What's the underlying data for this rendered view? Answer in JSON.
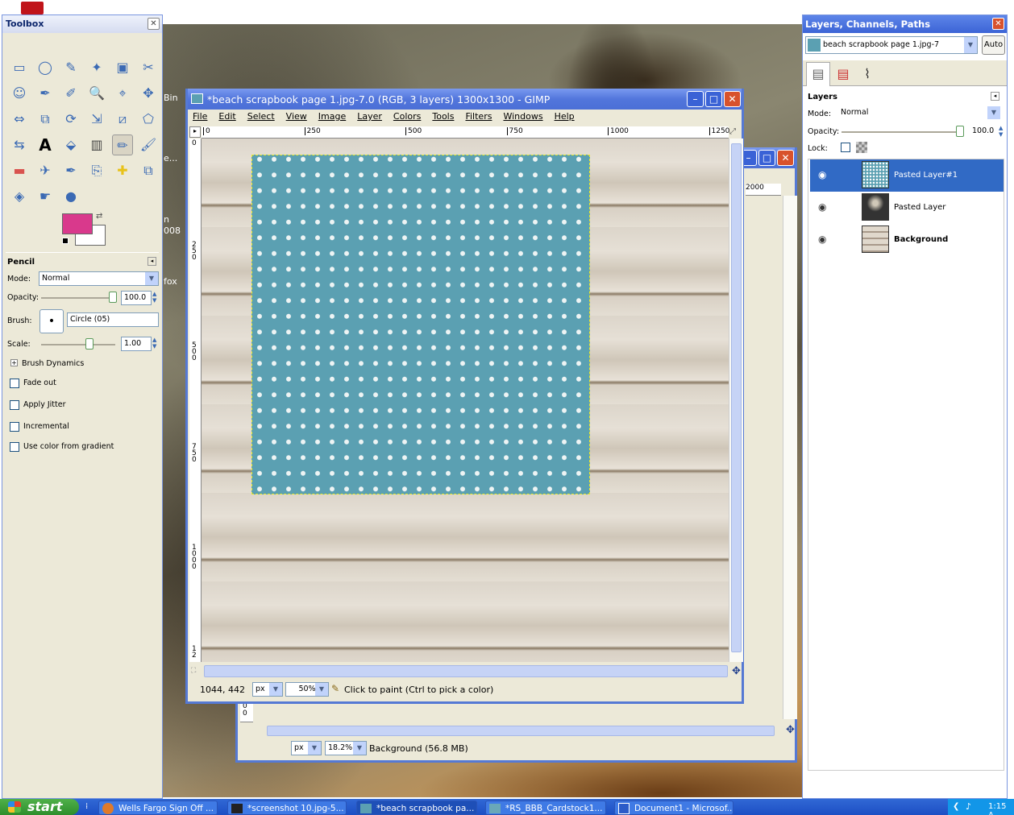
{
  "desktop": {
    "fragments": [
      "Bin",
      "e...",
      "n",
      "008",
      "fox"
    ]
  },
  "toolbox": {
    "title": "Toolbox",
    "tool_icons": [
      "rect-select-icon",
      "ellipse-select-icon",
      "free-select-icon",
      "fuzzy-select-icon",
      "color-select-icon",
      "scissors-icon",
      "foreground-select-icon",
      "paths-icon",
      "color-picker-icon",
      "zoom-icon",
      "measure-icon",
      "move-icon",
      "align-icon",
      "crop-icon",
      "rotate-icon",
      "scale-icon",
      "shear-icon",
      "perspective-icon",
      "flip-icon",
      "text-icon",
      "bucket-fill-icon",
      "blend-icon",
      "pencil-icon",
      "paintbrush-icon",
      "eraser-icon",
      "airbrush-icon",
      "ink-icon",
      "clone-icon",
      "heal-icon",
      "perspective-clone-icon",
      "blur-icon",
      "smudge-icon",
      "dodge-burn-icon"
    ],
    "fg_color": "#d9398c",
    "bg_color": "#ffffff",
    "options": {
      "title": "Pencil",
      "mode_label": "Mode:",
      "mode_value": "Normal",
      "opacity_label": "Opacity:",
      "opacity_value": "100.0",
      "brush_label": "Brush:",
      "brush_value": "Circle (05)",
      "scale_label": "Scale:",
      "scale_value": "1.00",
      "dynamics_label": "Brush Dynamics",
      "fade_label": "Fade out",
      "jitter_label": "Apply Jitter",
      "incremental_label": "Incremental",
      "gradient_label": "Use color from gradient"
    }
  },
  "back_window": {
    "ruler_label": "2000",
    "ruler_v": [
      "0",
      "0"
    ],
    "unit": "px",
    "zoom": "18.2%",
    "status": "Background (56.8 MB)"
  },
  "main_window": {
    "title": "*beach scrapbook page 1.jpg-7.0 (RGB, 3 layers) 1300x1300 - GIMP",
    "menu": [
      "File",
      "Edit",
      "Select",
      "View",
      "Image",
      "Layer",
      "Colors",
      "Tools",
      "Filters",
      "Windows",
      "Help"
    ],
    "ruler_h": [
      "0",
      "250",
      "500",
      "750",
      "1000",
      "1250"
    ],
    "ruler_v": [
      "0",
      "250",
      "500",
      "750",
      "1000",
      "12"
    ],
    "coords": "1044, 442",
    "unit": "px",
    "zoom": "50%",
    "status": "Click to paint (Ctrl to pick a color)"
  },
  "layers_dialog": {
    "title": "Layers, Channels, Paths",
    "image_select": "beach scrapbook page 1.jpg-7",
    "auto_label": "Auto",
    "section": "Layers",
    "mode_label": "Mode:",
    "mode_value": "Normal",
    "opacity_label": "Opacity:",
    "opacity_value": "100.0",
    "lock_label": "Lock:",
    "layers": [
      {
        "name": "Pasted Layer#1",
        "selected": true
      },
      {
        "name": "Pasted Layer",
        "selected": false
      },
      {
        "name": "Background",
        "selected": false
      }
    ]
  },
  "taskbar": {
    "start": "start",
    "tasks": [
      "Wells Fargo Sign Off ...",
      "*screenshot 10.jpg-5...",
      "*beach scrapbook pa...",
      "*RS_BBB_Cardstock1...",
      "Document1 - Microsof..."
    ],
    "clock": "1:15 A"
  }
}
